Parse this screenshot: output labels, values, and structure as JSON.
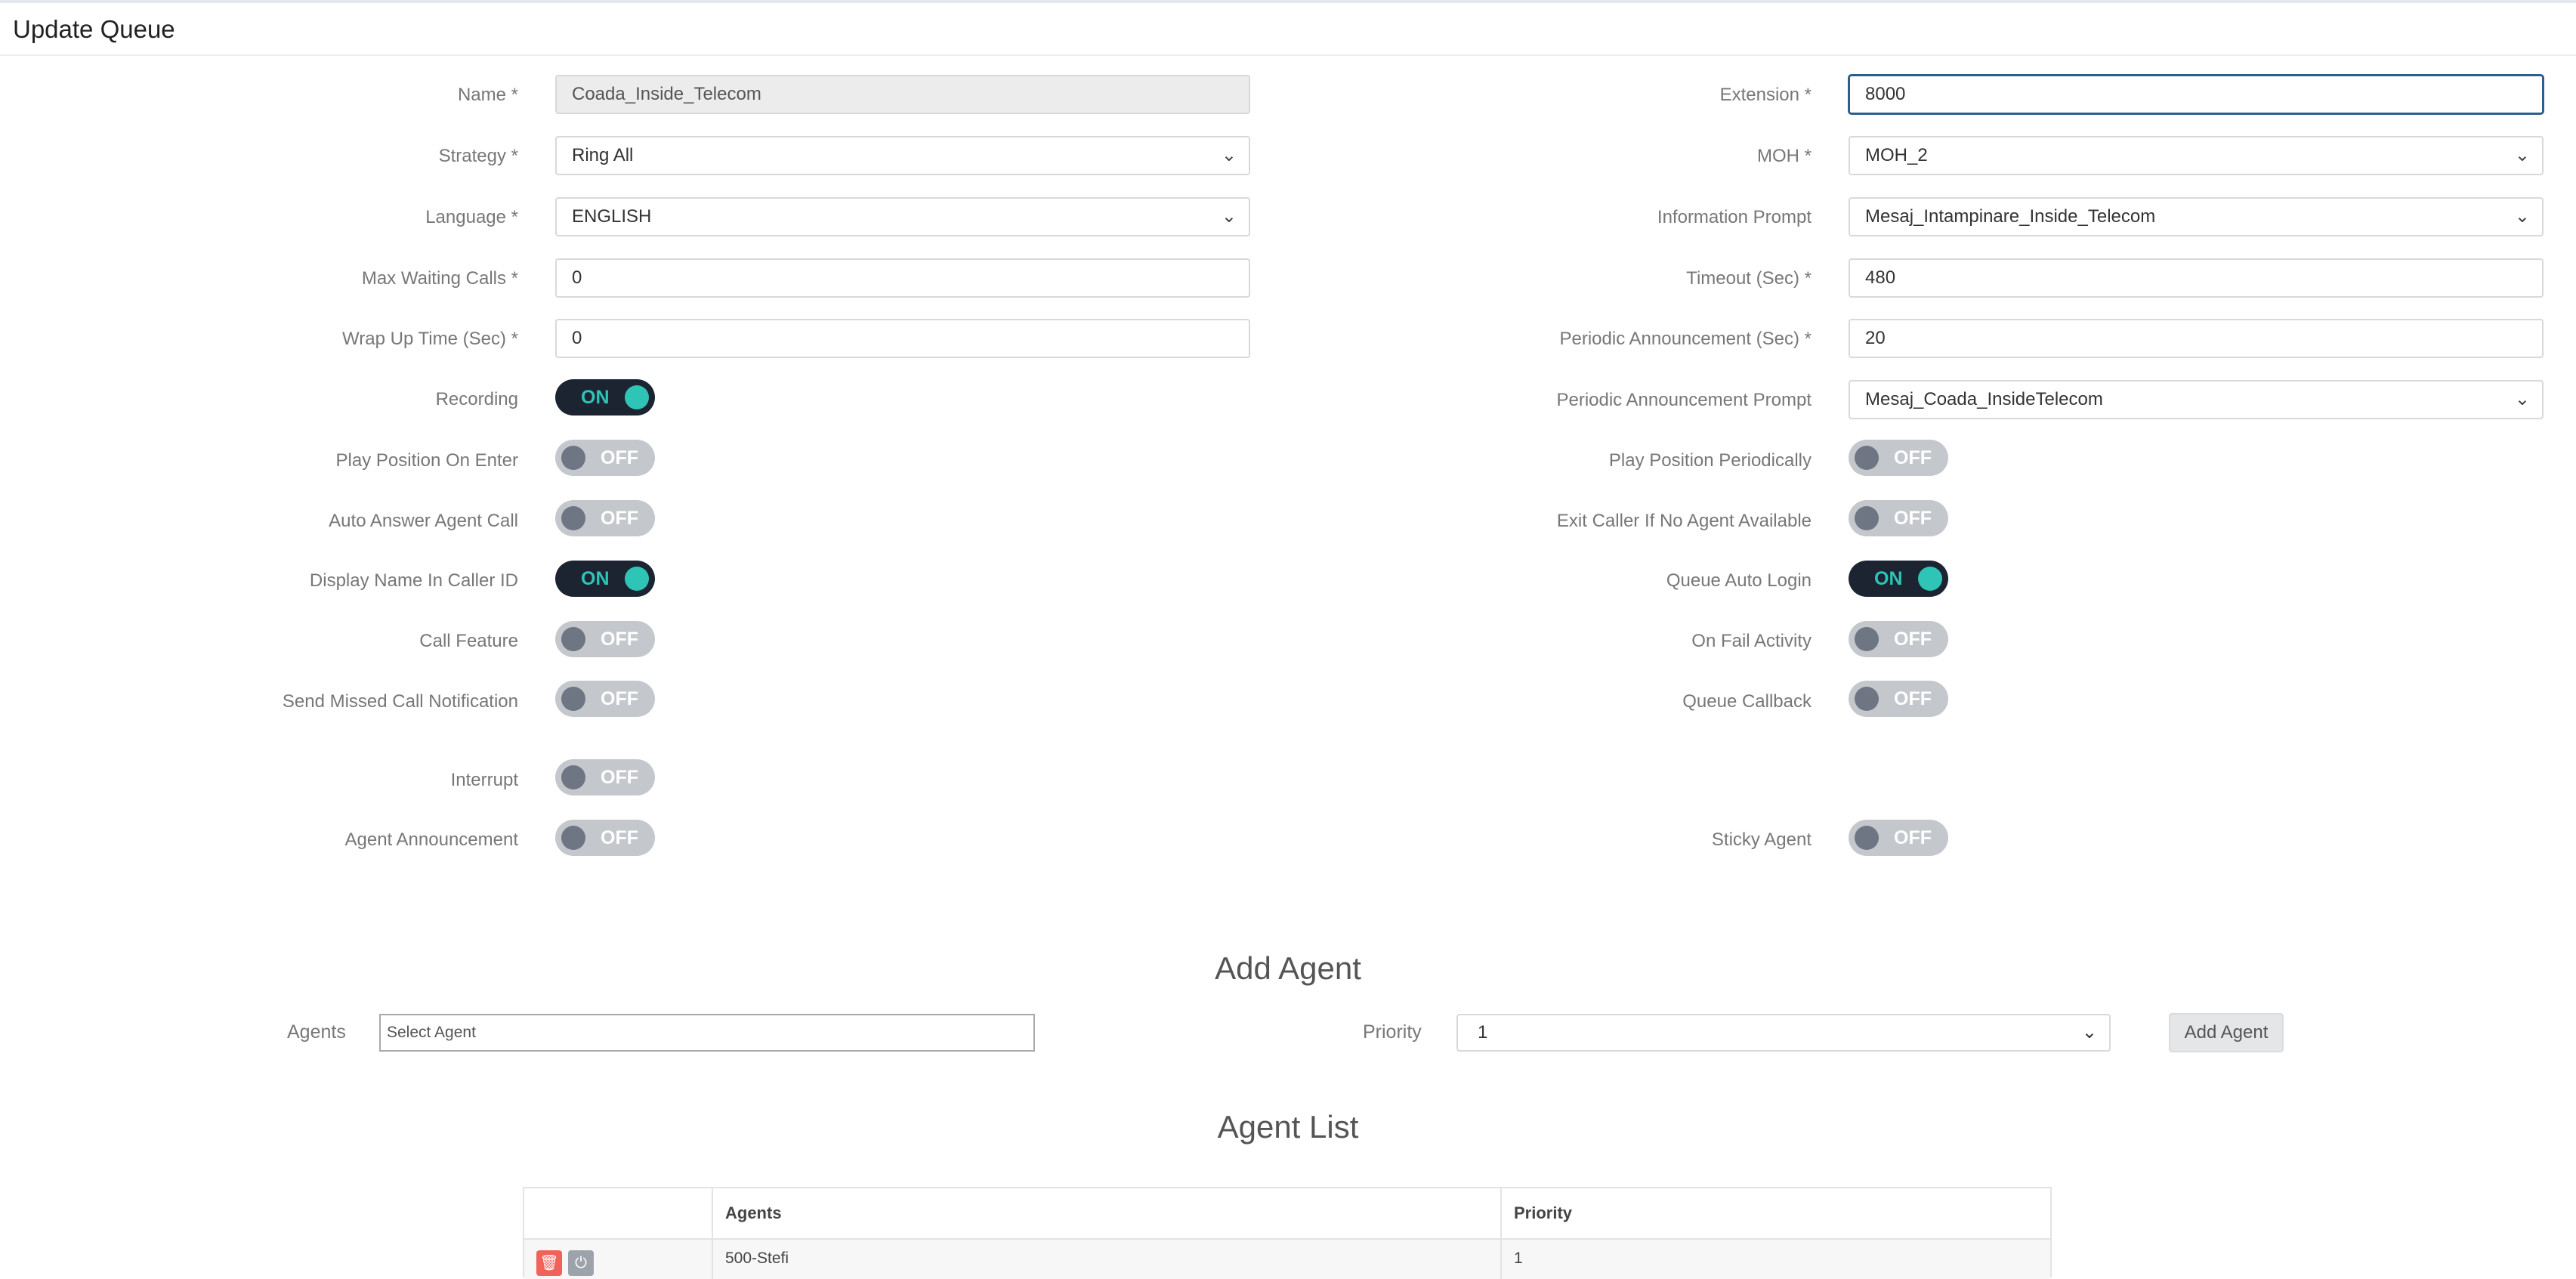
{
  "page": {
    "title": "Update Queue"
  },
  "form": {
    "left_fields": [
      {
        "label": "Name *",
        "value": "Coada_Inside_Telecom"
      },
      {
        "label": "Strategy *",
        "value": "Ring All"
      },
      {
        "label": "Language *",
        "value": "ENGLISH"
      },
      {
        "label": "Max Waiting Calls *",
        "value": "0"
      },
      {
        "label": "Wrap Up Time (Sec) *",
        "value": "0"
      }
    ],
    "right_fields": [
      {
        "label": "Extension *",
        "value": "8000"
      },
      {
        "label": "MOH *",
        "value": "MOH_2"
      },
      {
        "label": "Information Prompt",
        "value": "Mesaj_Intampinare_Inside_Telecom"
      },
      {
        "label": "Timeout (Sec) *",
        "value": "480"
      },
      {
        "label": "Periodic Announcement (Sec) *",
        "value": "20"
      },
      {
        "label": "Periodic Announcement Prompt",
        "value": "Mesaj_Coada_InsideTelecom"
      }
    ],
    "left_toggles": [
      {
        "label": "Recording",
        "state": "ON"
      },
      {
        "label": "Play Position On Enter",
        "state": "OFF"
      },
      {
        "label": "Auto Answer Agent Call",
        "state": "OFF"
      },
      {
        "label": "Display Name In Caller ID",
        "state": "ON"
      },
      {
        "label": "Call Feature",
        "state": "OFF"
      },
      {
        "label": "Send Missed Call Notification",
        "state": "OFF"
      },
      {
        "label": "Interrupt",
        "state": "OFF"
      },
      {
        "label": "Agent Announcement",
        "state": "OFF"
      }
    ],
    "right_toggles": [
      {
        "label": "Play Position Periodically",
        "state": "OFF"
      },
      {
        "label": "Exit Caller If No Agent Available",
        "state": "OFF"
      },
      {
        "label": "Queue Auto Login",
        "state": "ON"
      },
      {
        "label": "On Fail Activity",
        "state": "OFF"
      },
      {
        "label": "Queue Callback",
        "state": "OFF"
      },
      {
        "label": "Sticky Agent",
        "state": "OFF"
      }
    ]
  },
  "add_agent": {
    "title": "Add Agent",
    "agents_label": "Agents",
    "agents_placeholder": "Select Agent",
    "priority_label": "Priority",
    "priority_value": "1",
    "button_label": "Add Agent"
  },
  "agent_list": {
    "title": "Agent List",
    "columns": [
      "",
      "Agents",
      "Priority"
    ],
    "rows": [
      {
        "agent": "500-Stefi",
        "priority": "1"
      }
    ]
  },
  "colors": {
    "toggle_on_bg": "#1c2431",
    "toggle_on_accent": "#2ec4b6",
    "toggle_off_bg": "#c4c7cc",
    "delete_red": "#f0625a",
    "focus_border": "#2d5f8e"
  },
  "icons": [
    "chevron-down-icon",
    "trash-icon",
    "power-icon"
  ]
}
